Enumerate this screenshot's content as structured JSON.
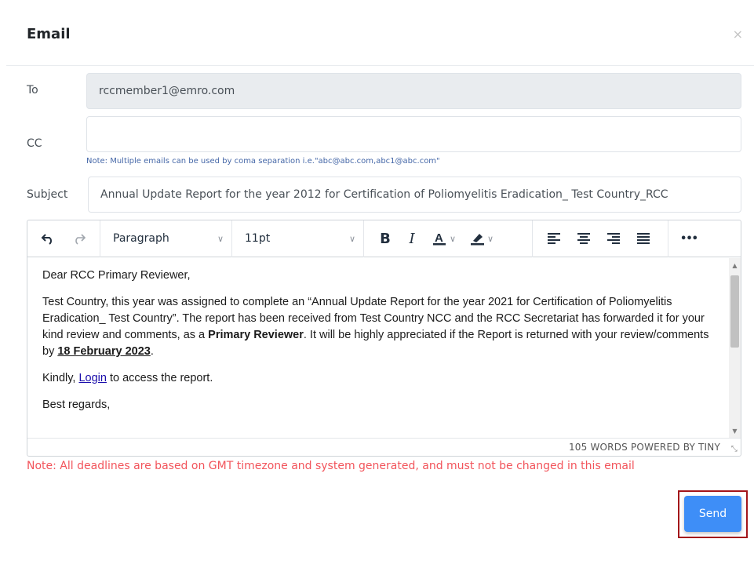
{
  "modal": {
    "title": "Email",
    "close_glyph": "×"
  },
  "to": {
    "label": "To",
    "value": "rccmember1@emro.com"
  },
  "cc": {
    "label": "CC",
    "value": "",
    "placeholder": "",
    "note": "Note: Multiple emails can be used by coma separation i.e.\"abc@abc.com,abc1@abc.com\""
  },
  "subject": {
    "label": "Subject",
    "value": "Annual Update Report for the year 2012 for Certification of Poliomyelitis Eradication_ Test Country_RCC"
  },
  "toolbar": {
    "undo_icon": "undo-icon",
    "redo_icon": "redo-icon",
    "block_format": "Paragraph",
    "font_size": "11pt",
    "bold_label": "B",
    "italic_label": "I",
    "more_label": "•••"
  },
  "body": {
    "greeting": "Dear RCC Primary Reviewer,",
    "para1_a": "Test Country, this year was assigned to complete an “Annual Update Report for the year 2021 for Certification of Poliomyelitis Eradication_ Test Country”. The report has been received from Test Country NCC and the RCC Secretariat has forwarded it for your kind review and comments, as a ",
    "para1_bold": "Primary Reviewer",
    "para1_b": ". It will be highly appreciated if the Report is returned with your review/comments by ",
    "para1_date": "18 February 2023",
    "para1_end": ".",
    "kindly_a": "Kindly, ",
    "kindly_link": "Login",
    "kindly_b": " to access the report.",
    "regards": "Best regards,"
  },
  "statusbar": {
    "text": "105 WORDS  POWERED BY TINY"
  },
  "deadline_note": "Note: All deadlines are based on GMT timezone and system generated, and must not be changed in this email",
  "send_button": {
    "label": "Send",
    "color": "#3e8ef7"
  },
  "colors": {
    "error": "#f2545b",
    "highlight_border": "#a3151a",
    "note_blue": "#4668a8"
  }
}
